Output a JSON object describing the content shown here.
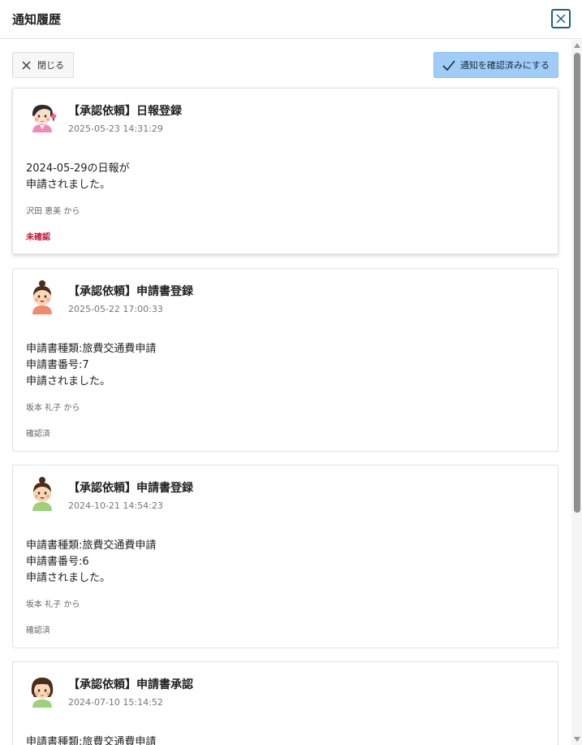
{
  "header": {
    "title": "通知履歴",
    "close_icon": "close-icon"
  },
  "toolbar": {
    "close_label": "閉じる",
    "confirm_label": "通知を確認済みにする",
    "accent_color": "#9fcdf8"
  },
  "notifications": [
    {
      "title": "【承認依頼】日報登録",
      "time": "2025-05-23 14:31:29",
      "body": [
        "2024-05-29の日報が",
        "申請されました。"
      ],
      "from": "沢田 恵美 から",
      "status": "未確認",
      "avatar": "woman-dark-hair-avatar"
    },
    {
      "title": "【承認依頼】申請書登録",
      "time": "2025-05-22 17:00:33",
      "body": [
        "申請書種類:旅費交通費申請",
        "申請書番号:7",
        "申請されました。"
      ],
      "from": "坂本 礼子 から",
      "status": "確認済",
      "avatar": "woman-bun-avatar"
    },
    {
      "title": "【承認依頼】申請書登録",
      "time": "2024-10-21 14:54:23",
      "body": [
        "申請書種類:旅費交通費申請",
        "申請書番号:6",
        "申請されました。"
      ],
      "from": "坂本 礼子 から",
      "status": "確認済",
      "avatar": "woman-bun-avatar"
    },
    {
      "title": "【承認依頼】申請書承認",
      "time": "2024-07-10 15:14:52",
      "body": [
        "申請書種類:旅費交通費申請"
      ],
      "from": "",
      "status": "",
      "avatar": "woman-bob-avatar"
    }
  ],
  "colors": {
    "unread_status": "#c8102e",
    "header_close_border": "#1f5d8f"
  }
}
